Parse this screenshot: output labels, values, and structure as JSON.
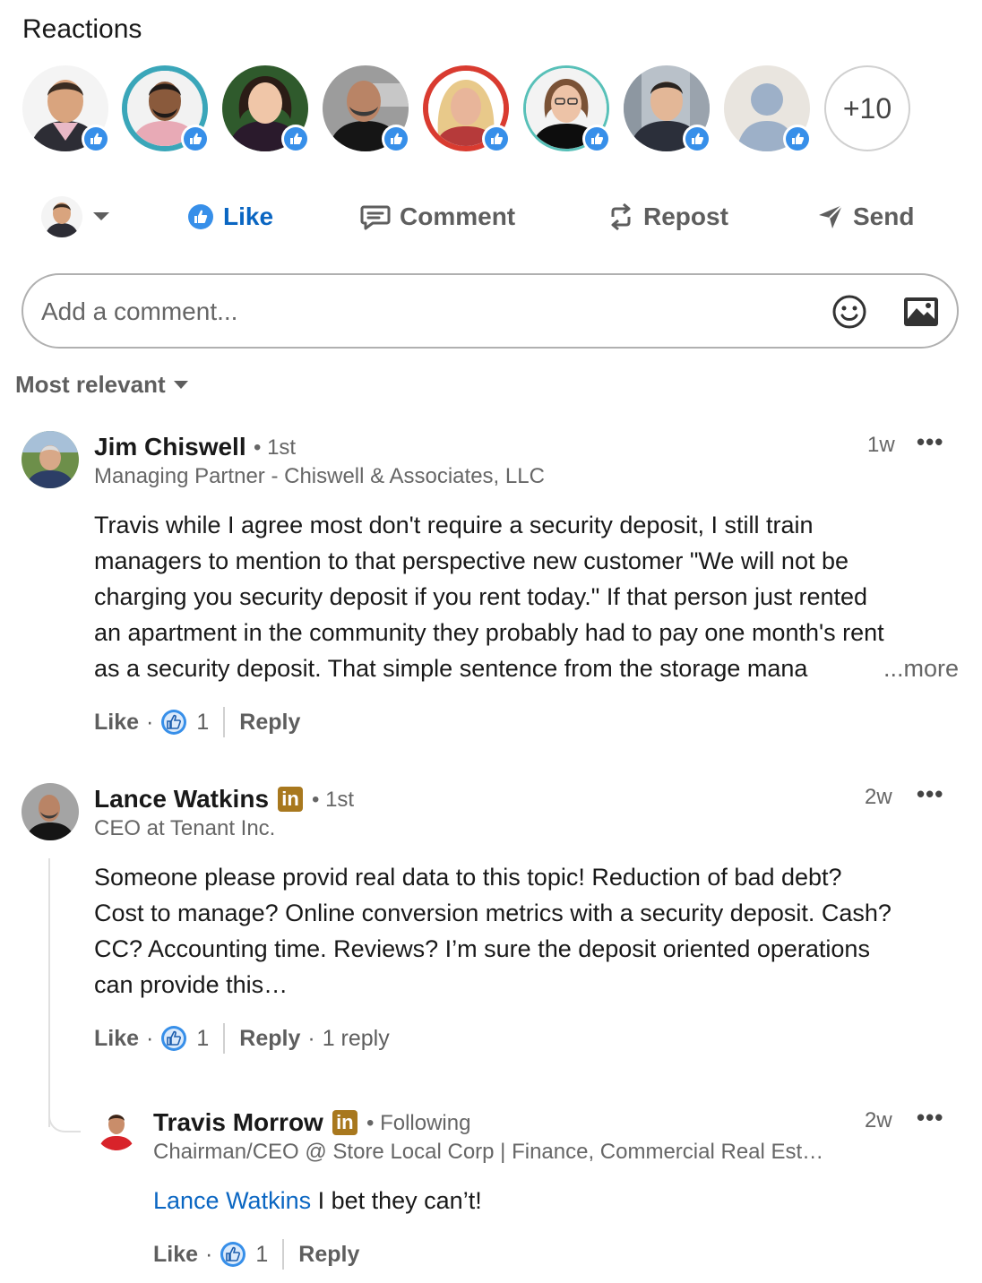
{
  "reactions": {
    "title": "Reactions",
    "more_count": "+10"
  },
  "actions": {
    "like": "Like",
    "comment": "Comment",
    "repost": "Repost",
    "send": "Send"
  },
  "comment_box": {
    "placeholder": "Add a comment..."
  },
  "sort": {
    "label": "Most relevant"
  },
  "comments": [
    {
      "name": "Jim Chiswell",
      "degree": "• 1st",
      "headline": "Managing Partner - Chiswell & Associates, LLC",
      "time": "1w",
      "lines": [
        "Travis while I agree most don't require a security deposit, I still train",
        "managers to mention to that perspective new customer \"We will not be",
        "charging you security deposit if you rent today.\" If that person just rented",
        "an apartment in the community they probably had to pay one month's rent",
        "as a security deposit. That simple sentence from the storage mana"
      ],
      "more": "...more",
      "like": "Like",
      "like_count": "1",
      "reply": "Reply"
    },
    {
      "name": "Lance Watkins",
      "badge": "in",
      "degree": "• 1st",
      "headline": "CEO at Tenant Inc.",
      "time": "2w",
      "lines": [
        "Someone please provid real data to this topic! Reduction of bad debt?",
        "Cost to manage? Online conversion metrics with a security deposit. Cash?",
        "CC? Accounting time. Reviews? I’m sure the deposit oriented operations",
        "can provide this…"
      ],
      "like": "Like",
      "like_count": "1",
      "reply": "Reply",
      "reply_count": "1 reply"
    }
  ],
  "reply": {
    "name": "Travis Morrow",
    "badge": "in",
    "degree": "• Following",
    "headline": "Chairman/CEO @ Store Local Corp | Finance, Commercial Real Est…",
    "time": "2w",
    "mention": "Lance Watkins",
    "text": " I bet they can’t!",
    "like": "Like",
    "like_count": "1",
    "reply": "Reply"
  },
  "colors": {
    "accent": "#0a66c2",
    "like_blue": "#378fe9",
    "premium_badge": "#a8781e"
  },
  "icons": [
    "thumbs-up-icon",
    "comment-icon",
    "repost-icon",
    "send-icon",
    "emoji-icon",
    "image-icon",
    "caret-down-icon",
    "more-dots-icon"
  ]
}
